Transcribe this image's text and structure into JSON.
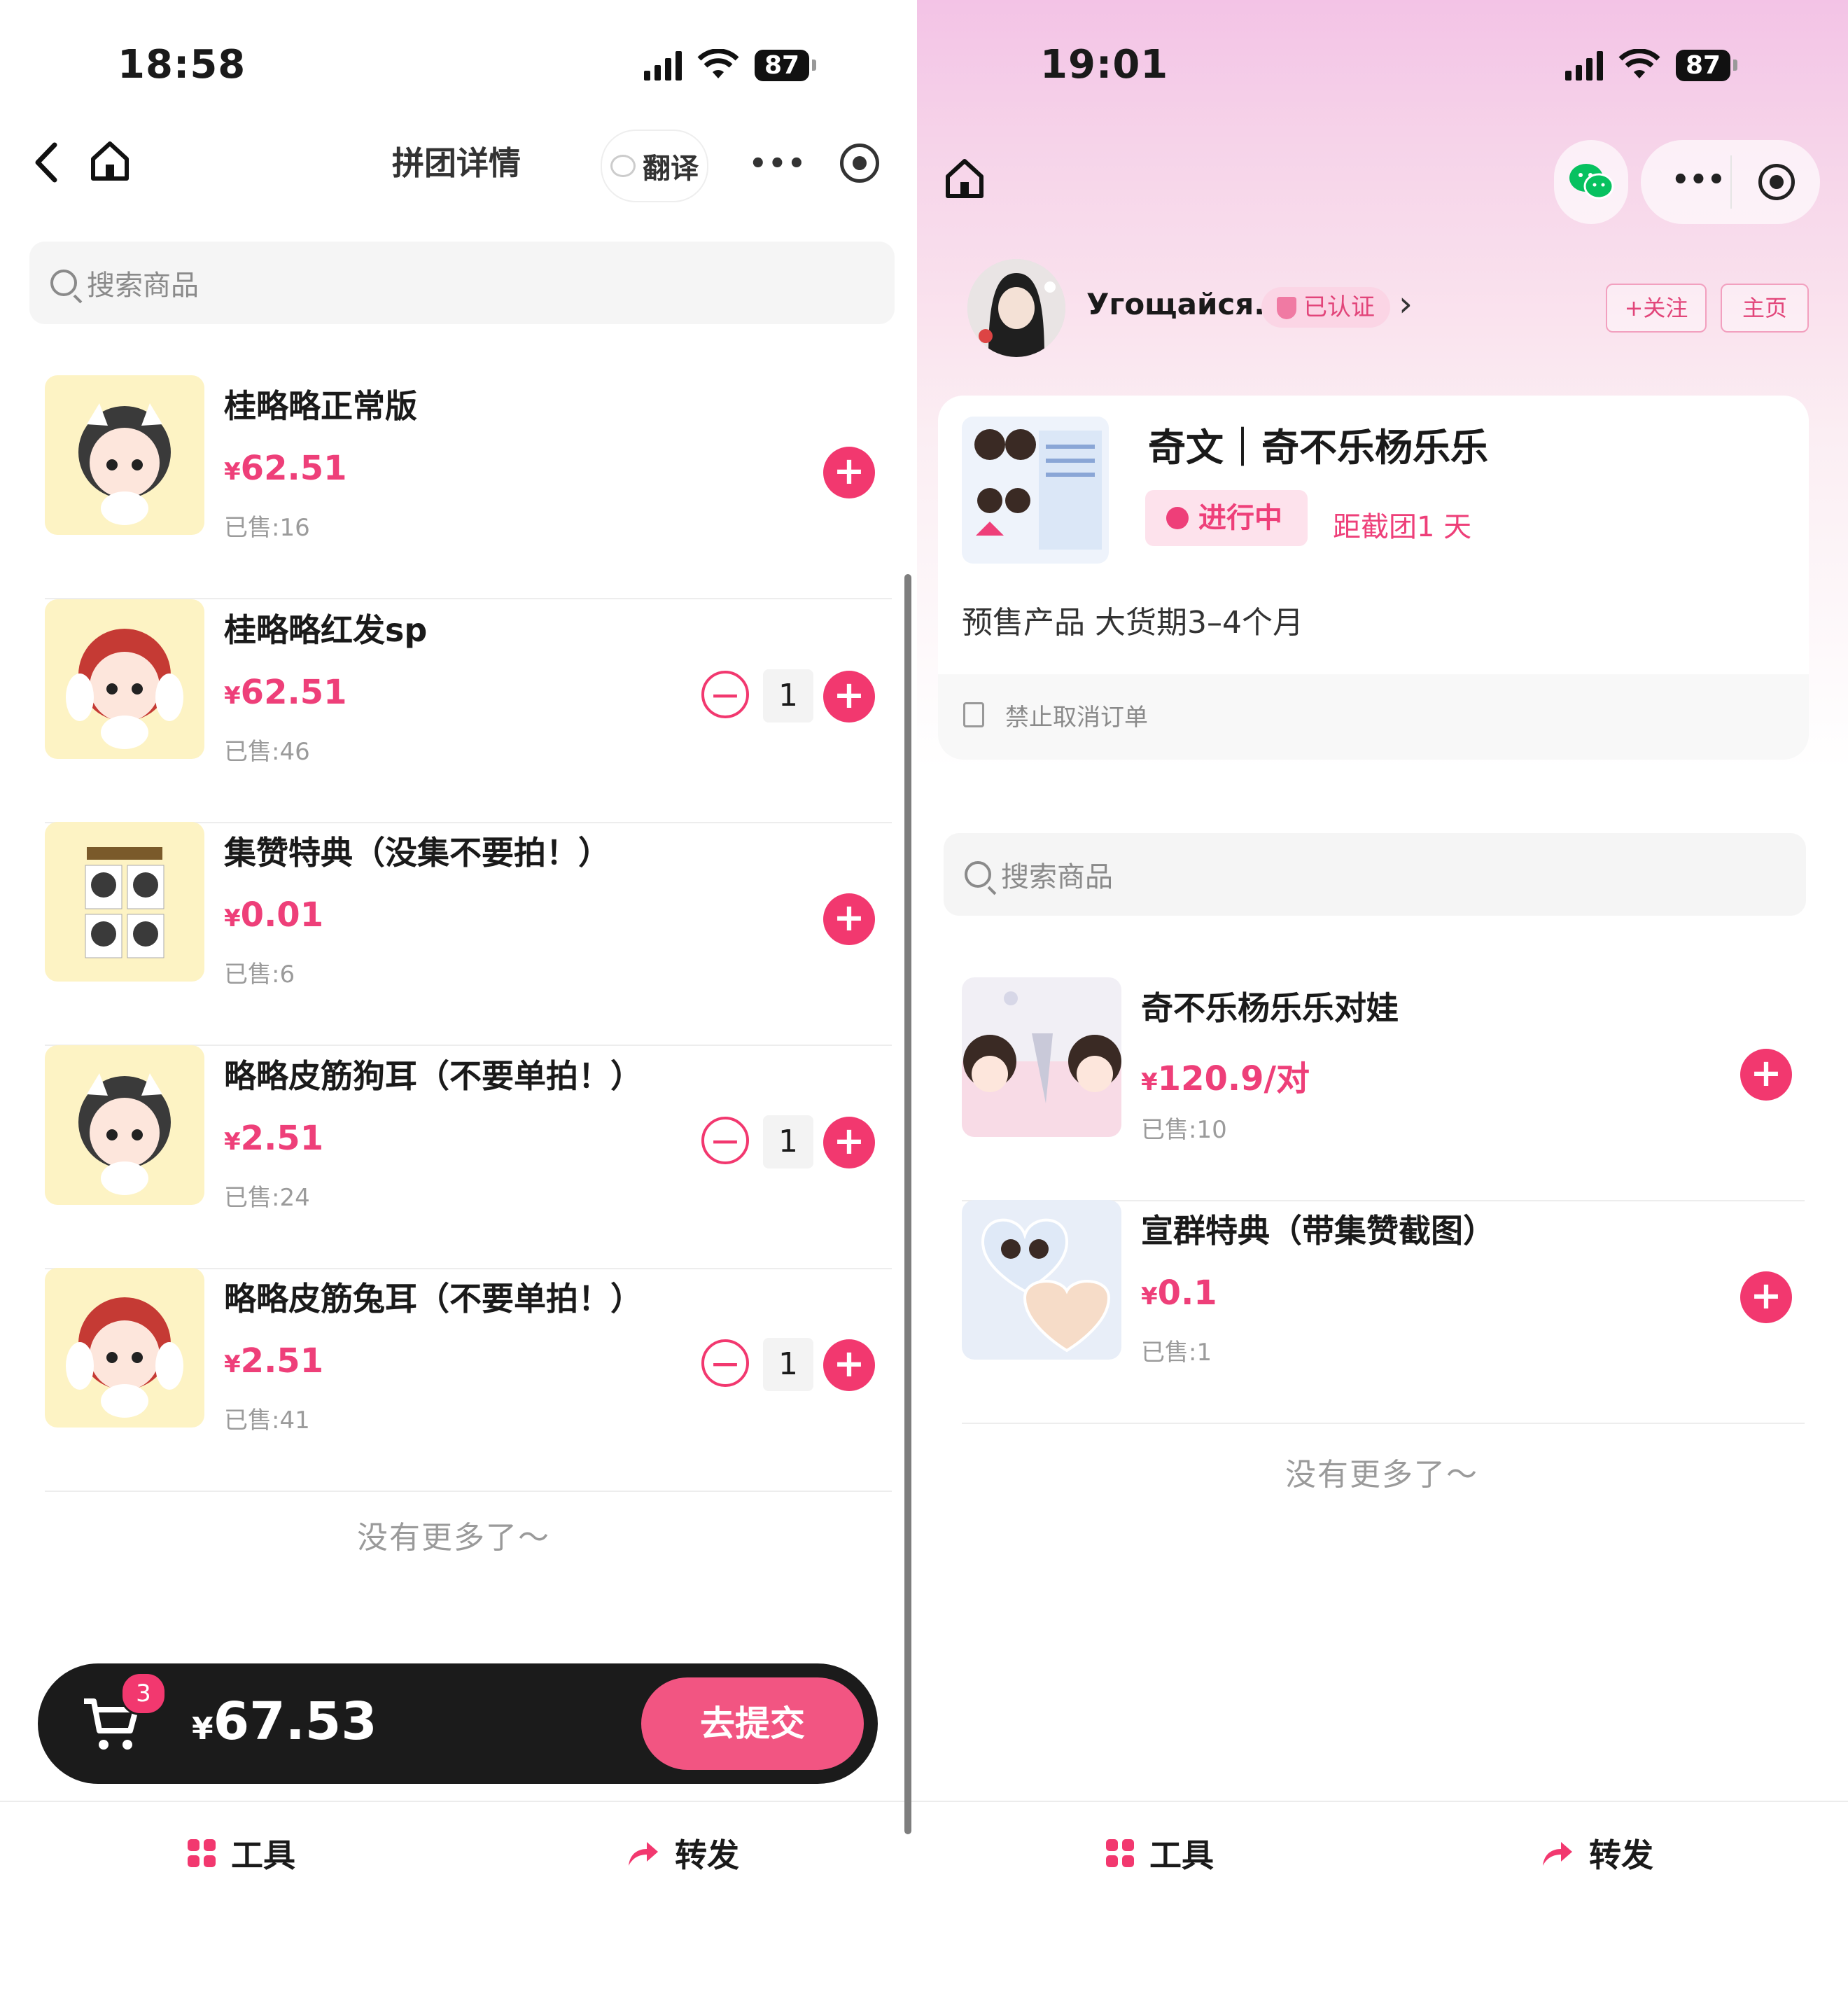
{
  "left": {
    "status": {
      "time": "18:58",
      "battery": "87"
    },
    "nav": {
      "title": "拼团详情",
      "translate": "翻译",
      "more": "•••"
    },
    "search": {
      "placeholder": "搜索商品"
    },
    "products": [
      {
        "name": "桂略略正常版",
        "price": "62.51",
        "sold": "已售:16",
        "qty": null
      },
      {
        "name": "桂略略红发sp",
        "price": "62.51",
        "sold": "已售:46",
        "qty": "1"
      },
      {
        "name": "集赞特典（没集不要拍！）",
        "price": "0.01",
        "sold": "已售:6",
        "qty": null
      },
      {
        "name": "略略皮筋狗耳（不要单拍！）",
        "price": "2.51",
        "sold": "已售:24",
        "qty": "1"
      },
      {
        "name": "略略皮筋兔耳（不要单拍！）",
        "price": "2.51",
        "sold": "已售:41",
        "qty": "1"
      }
    ],
    "no_more": "没有更多了～",
    "cart": {
      "badge": "3",
      "currency": "¥",
      "total": "67.53",
      "submit": "去提交"
    },
    "tabs": {
      "tools": "工具",
      "share": "转发"
    }
  },
  "right": {
    "status": {
      "time": "19:01",
      "battery": "87"
    },
    "profile": {
      "name": "Угощайся.",
      "verified": "已认证",
      "follow": "+关注",
      "home": "主页"
    },
    "group": {
      "title": "奇文｜奇不乐杨乐乐",
      "status": "进行中",
      "deadline": "距截团1 天",
      "note": "预售产品 大货期3–4个月",
      "policy": "禁止取消订单"
    },
    "search": {
      "placeholder": "搜索商品"
    },
    "products": [
      {
        "name": "奇不乐杨乐乐对娃",
        "price": "120.9/对",
        "sold": "已售:10"
      },
      {
        "name": "宣群特典（带集赞截图）",
        "price": "0.1",
        "sold": "已售:1"
      }
    ],
    "no_more": "没有更多了～",
    "tabs": {
      "tools": "工具",
      "share": "转发"
    }
  },
  "currency_symbol": "¥",
  "colors": {
    "accent": "#f2386f",
    "price": "#ee3f79",
    "cart_bg": "#1b1b1b"
  },
  "icons": [
    "back-icon",
    "home-icon",
    "more-icon",
    "target-icon",
    "search-icon",
    "plus-icon",
    "minus-icon",
    "cart-icon",
    "grid-icon",
    "share-icon",
    "wechat-icon",
    "chevron-right-icon",
    "clock-icon",
    "document-icon"
  ]
}
